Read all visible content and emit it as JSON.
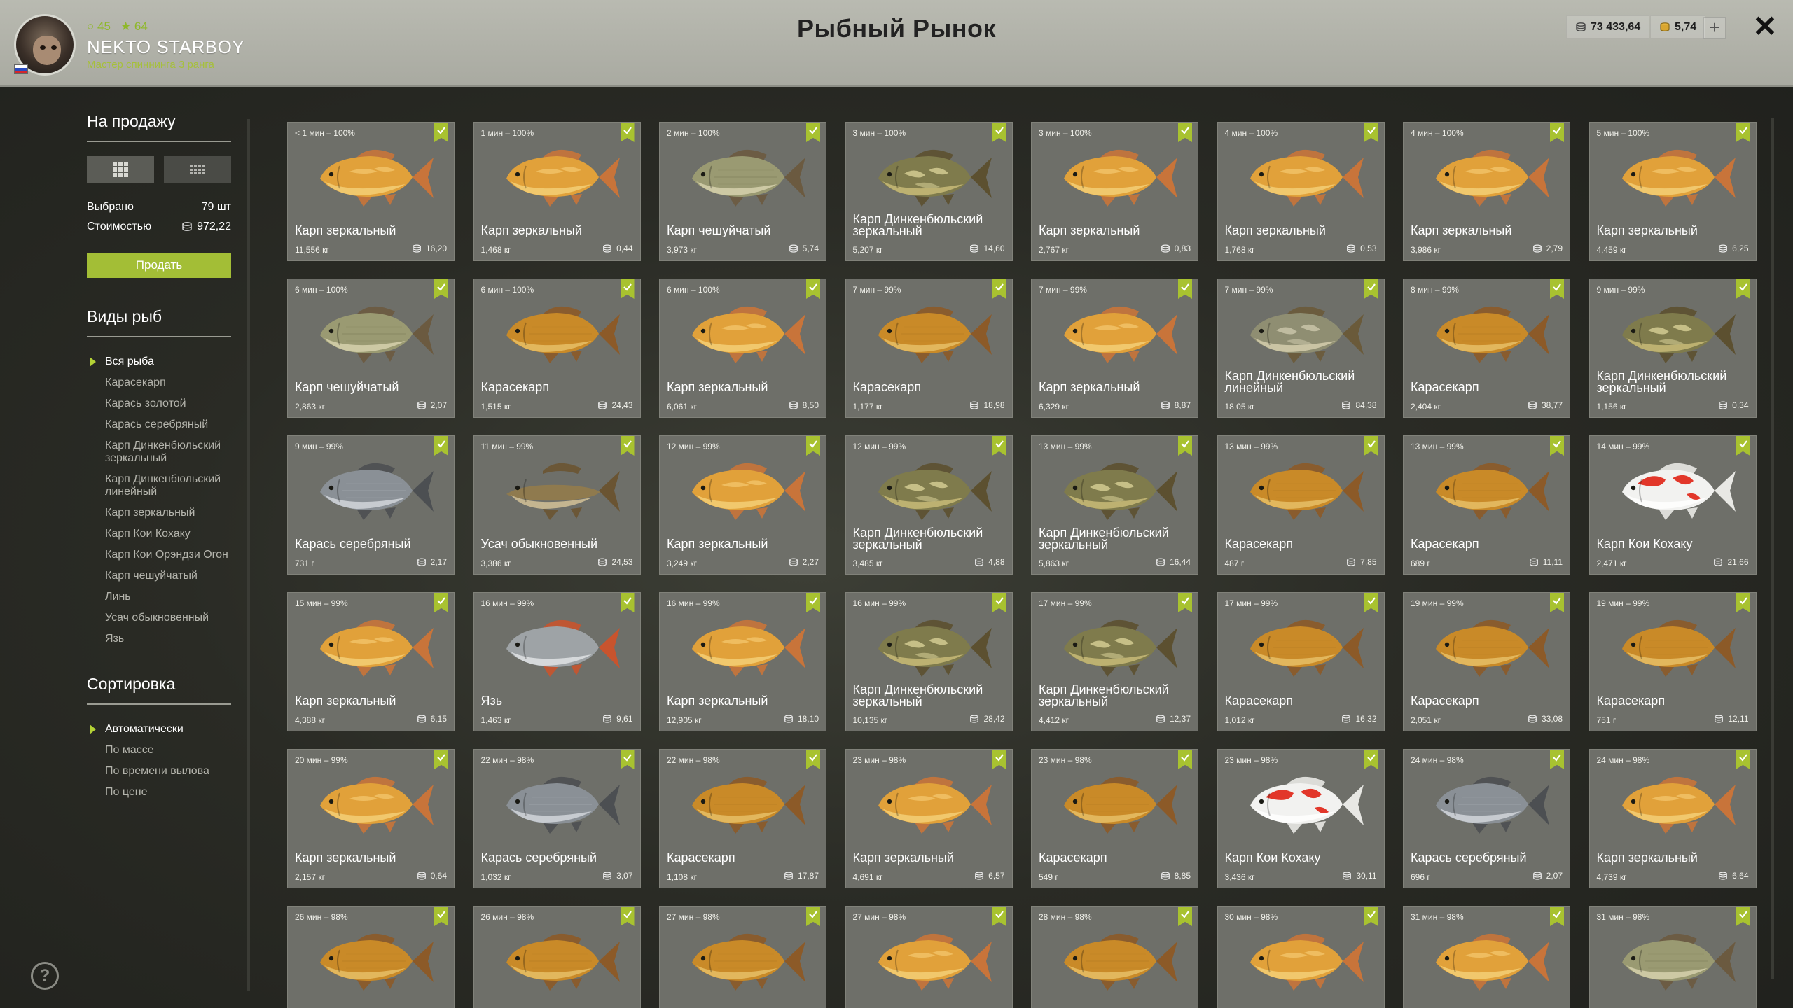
{
  "player": {
    "level": "45",
    "stars": "64",
    "name": "NEKTO STARBOY",
    "rank": "Мастер спиннинга 3 ранга"
  },
  "title": "Рыбный Рынок",
  "currency": {
    "silver": "73 433,64",
    "gold": "5,74"
  },
  "sidebar": {
    "sale_title": "На продажу",
    "selected_label": "Выбрано",
    "selected_value": "79 шт",
    "cost_label": "Стоимостью",
    "cost_value": "972,22",
    "sell_button": "Продать",
    "species_title": "Виды рыб",
    "species": [
      "Вся рыба",
      "Карасекарп",
      "Карась золотой",
      "Карась серебряный",
      "Карп Динкенбюльский зеркальный",
      "Карп Динкенбюльский линейный",
      "Карп зеркальный",
      "Карп Кои Кохаку",
      "Карп Кои Орэндзи Огон",
      "Карп чешуйчатый",
      "Линь",
      "Усач обыкновенный",
      "Язь"
    ],
    "sort_title": "Сортировка",
    "sort_options": [
      "Автоматически",
      "По массе",
      "По времени вылова",
      "По цене"
    ]
  },
  "fish_cards": [
    {
      "time": "< 1 мин – 100%",
      "name": "Карп зеркальный",
      "weight": "11,556 кг",
      "price": "16,20",
      "type": "mirror"
    },
    {
      "time": "1 мин – 100%",
      "name": "Карп зеркальный",
      "weight": "1,468 кг",
      "price": "0,44",
      "type": "mirror"
    },
    {
      "time": "2 мин – 100%",
      "name": "Карп чешуйчатый",
      "weight": "3,973 кг",
      "price": "5,74",
      "type": "scaled"
    },
    {
      "time": "3 мин – 100%",
      "name": "Карп Динкенбюльский зеркальный",
      "weight": "5,207 кг",
      "price": "14,60",
      "type": "dink"
    },
    {
      "time": "3 мин – 100%",
      "name": "Карп зеркальный",
      "weight": "2,767 кг",
      "price": "0,83",
      "type": "mirror"
    },
    {
      "time": "4 мин – 100%",
      "name": "Карп зеркальный",
      "weight": "1,768 кг",
      "price": "0,53",
      "type": "mirror"
    },
    {
      "time": "4 мин – 100%",
      "name": "Карп зеркальный",
      "weight": "3,986 кг",
      "price": "2,79",
      "type": "mirror"
    },
    {
      "time": "5 мин – 100%",
      "name": "Карп зеркальный",
      "weight": "4,459 кг",
      "price": "6,25",
      "type": "mirror"
    },
    {
      "time": "6 мин – 100%",
      "name": "Карп чешуйчатый",
      "weight": "2,863 кг",
      "price": "2,07",
      "type": "scaled"
    },
    {
      "time": "6 мин – 100%",
      "name": "Карасекарп",
      "weight": "1,515 кг",
      "price": "24,43",
      "type": "cruc"
    },
    {
      "time": "6 мин – 100%",
      "name": "Карп зеркальный",
      "weight": "6,061 кг",
      "price": "8,50",
      "type": "mirror"
    },
    {
      "time": "7 мин – 99%",
      "name": "Карасекарп",
      "weight": "1,177 кг",
      "price": "18,98",
      "type": "cruc"
    },
    {
      "time": "7 мин – 99%",
      "name": "Карп зеркальный",
      "weight": "6,329 кг",
      "price": "8,87",
      "type": "mirror"
    },
    {
      "time": "7 мин – 99%",
      "name": "Карп Динкенбюльский линейный",
      "weight": "18,05 кг",
      "price": "84,38",
      "type": "dinkline"
    },
    {
      "time": "8 мин – 99%",
      "name": "Карасекарп",
      "weight": "2,404 кг",
      "price": "38,77",
      "type": "cruc"
    },
    {
      "time": "9 мин – 99%",
      "name": "Карп Динкенбюльский зеркальный",
      "weight": "1,156 кг",
      "price": "0,34",
      "type": "dink"
    },
    {
      "time": "9 мин – 99%",
      "name": "Карась серебряный",
      "weight": "731 г",
      "price": "2,17",
      "type": "silver"
    },
    {
      "time": "11 мин – 99%",
      "name": "Усач обыкновенный",
      "weight": "3,386 кг",
      "price": "24,53",
      "type": "barbel"
    },
    {
      "time": "12 мин – 99%",
      "name": "Карп зеркальный",
      "weight": "3,249 кг",
      "price": "2,27",
      "type": "mirror"
    },
    {
      "time": "12 мин – 99%",
      "name": "Карп Динкенбюльский зеркальный",
      "weight": "3,485 кг",
      "price": "4,88",
      "type": "dink"
    },
    {
      "time": "13 мин – 99%",
      "name": "Карп Динкенбюльский зеркальный",
      "weight": "5,863 кг",
      "price": "16,44",
      "type": "dink"
    },
    {
      "time": "13 мин – 99%",
      "name": "Карасекарп",
      "weight": "487 г",
      "price": "7,85",
      "type": "cruc"
    },
    {
      "time": "13 мин – 99%",
      "name": "Карасекарп",
      "weight": "689 г",
      "price": "11,11",
      "type": "cruc"
    },
    {
      "time": "14 мин – 99%",
      "name": "Карп Кои Кохаку",
      "weight": "2,471 кг",
      "price": "21,66",
      "type": "koi"
    },
    {
      "time": "15 мин – 99%",
      "name": "Карп зеркальный",
      "weight": "4,388 кг",
      "price": "6,15",
      "type": "mirror"
    },
    {
      "time": "16 мин – 99%",
      "name": "Язь",
      "weight": "1,463 кг",
      "price": "9,61",
      "type": "ide"
    },
    {
      "time": "16 мин – 99%",
      "name": "Карп зеркальный",
      "weight": "12,905 кг",
      "price": "18,10",
      "type": "mirror"
    },
    {
      "time": "16 мин – 99%",
      "name": "Карп Динкенбюльский зеркальный",
      "weight": "10,135 кг",
      "price": "28,42",
      "type": "dink"
    },
    {
      "time": "17 мин – 99%",
      "name": "Карп Динкенбюльский зеркальный",
      "weight": "4,412 кг",
      "price": "12,37",
      "type": "dink"
    },
    {
      "time": "17 мин – 99%",
      "name": "Карасекарп",
      "weight": "1,012 кг",
      "price": "16,32",
      "type": "cruc"
    },
    {
      "time": "19 мин – 99%",
      "name": "Карасекарп",
      "weight": "2,051 кг",
      "price": "33,08",
      "type": "cruc"
    },
    {
      "time": "19 мин – 99%",
      "name": "Карасекарп",
      "weight": "751 г",
      "price": "12,11",
      "type": "cruc"
    },
    {
      "time": "20 мин – 99%",
      "name": "Карп зеркальный",
      "weight": "2,157 кг",
      "price": "0,64",
      "type": "mirror"
    },
    {
      "time": "22 мин – 98%",
      "name": "Карась серебряный",
      "weight": "1,032 кг",
      "price": "3,07",
      "type": "silver"
    },
    {
      "time": "22 мин – 98%",
      "name": "Карасекарп",
      "weight": "1,108 кг",
      "price": "17,87",
      "type": "cruc"
    },
    {
      "time": "23 мин – 98%",
      "name": "Карп зеркальный",
      "weight": "4,691 кг",
      "price": "6,57",
      "type": "mirror"
    },
    {
      "time": "23 мин – 98%",
      "name": "Карасекарп",
      "weight": "549 г",
      "price": "8,85",
      "type": "cruc"
    },
    {
      "time": "23 мин – 98%",
      "name": "Карп Кои Кохаку",
      "weight": "3,436 кг",
      "price": "30,11",
      "type": "koi"
    },
    {
      "time": "24 мин – 98%",
      "name": "Карась серебряный",
      "weight": "696 г",
      "price": "2,07",
      "type": "silver"
    },
    {
      "time": "24 мин – 98%",
      "name": "Карп зеркальный",
      "weight": "4,739 кг",
      "price": "6,64",
      "type": "mirror"
    },
    {
      "time": "26 мин – 98%",
      "name": "",
      "weight": "",
      "price": "",
      "type": "cruc"
    },
    {
      "time": "26 мин – 98%",
      "name": "",
      "weight": "",
      "price": "",
      "type": "cruc"
    },
    {
      "time": "27 мин – 98%",
      "name": "",
      "weight": "",
      "price": "",
      "type": "cruc"
    },
    {
      "time": "27 мин – 98%",
      "name": "",
      "weight": "",
      "price": "",
      "type": "mirror"
    },
    {
      "time": "28 мин – 98%",
      "name": "",
      "weight": "",
      "price": "",
      "type": "cruc"
    },
    {
      "time": "30 мин – 98%",
      "name": "",
      "weight": "",
      "price": "",
      "type": "mirror"
    },
    {
      "time": "31 мин – 98%",
      "name": "",
      "weight": "",
      "price": "",
      "type": "mirror"
    },
    {
      "time": "31 мин – 98%",
      "name": "",
      "weight": "",
      "price": "",
      "type": "scaled"
    }
  ],
  "fish_colors": {
    "mirror": {
      "body": "#e1a13a",
      "belly": "#f5d27a",
      "fin": "#c8743a",
      "mark": "#f3c46a"
    },
    "scaled": {
      "body": "#9a9a72",
      "belly": "#d9d4b0",
      "fin": "#6b5a40",
      "mark": "#7d7d5a"
    },
    "cruc": {
      "body": "#c98a28",
      "belly": "#e8c26a",
      "fin": "#8c5a28",
      "mark": "#b27a22"
    },
    "dink": {
      "body": "#7f7b4c",
      "belly": "#cdbf7a",
      "fin": "#5c5030",
      "mark": "#d2cb92"
    },
    "dinkline": {
      "body": "#8f8e72",
      "belly": "#d8d2b0",
      "fin": "#6a5a3a",
      "mark": "#c9c4a8"
    },
    "silver": {
      "body": "#8a9096",
      "belly": "#d6dade",
      "fin": "#4c4f52",
      "mark": "#a8aeb4"
    },
    "barbel": {
      "body": "#8f7a4e",
      "belly": "#d9c79a",
      "fin": "#6a5432",
      "mark": "#a08a5c"
    },
    "koi": {
      "body": "#f2f2f0",
      "belly": "#ffffff",
      "fin": "#e8e8e4",
      "mark": "#e2372a"
    },
    "ide": {
      "body": "#9ea3a6",
      "belly": "#e4e6e8",
      "fin": "#c8542e",
      "mark": "#b4b9bc"
    }
  },
  "accent_color": "#a8c230"
}
